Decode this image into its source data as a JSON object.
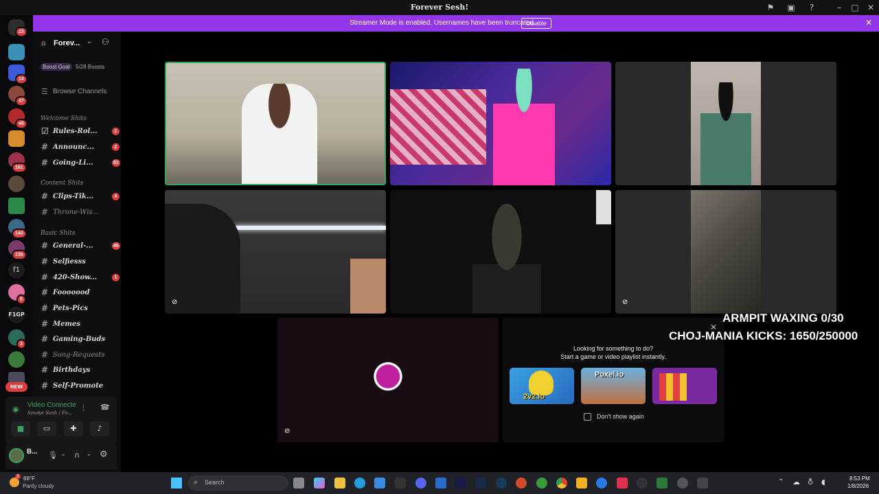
{
  "window": {
    "title": "Forever Sesh!"
  },
  "banner": {
    "text": "Streamer Mode is enabled. Usernames have been truncated.",
    "button": "Disable"
  },
  "guild_badges": [
    "23",
    "14",
    "47",
    "45",
    "161",
    "140",
    "136",
    "5",
    "3"
  ],
  "guild_text": {
    "f1": "f1",
    "f1gp": "F1GP",
    "new": "NEW"
  },
  "server": {
    "name": "Forev...",
    "boost_goal": "Boost Goal",
    "boosts": "5/28 Boosts",
    "browse": "Browse Channels"
  },
  "categories": [
    {
      "name": "Welcome Shits"
    },
    {
      "name": "Content Shits"
    },
    {
      "name": "Basic Shits"
    }
  ],
  "channels": [
    {
      "label": "Rules-Rol...",
      "badge": "2"
    },
    {
      "label": "Announc...",
      "badge": "2"
    },
    {
      "label": "Going-Li...",
      "badge": "81"
    },
    {
      "label": "Clips-Tik...",
      "badge": "4"
    },
    {
      "label": "Throne-Wis...",
      "badge": ""
    },
    {
      "label": "General-...",
      "badge": "46"
    },
    {
      "label": "Selfiesss",
      "badge": ""
    },
    {
      "label": "420-Show...",
      "badge": "1"
    },
    {
      "label": "Fooooood",
      "badge": ""
    },
    {
      "label": "Pets-Pics",
      "badge": ""
    },
    {
      "label": "Memes",
      "badge": ""
    },
    {
      "label": "Gaming-Buds",
      "badge": ""
    },
    {
      "label": "Song-Requests",
      "badge": ""
    },
    {
      "label": "Birthdays",
      "badge": ""
    },
    {
      "label": "Self-Promote",
      "badge": ""
    }
  ],
  "voice": {
    "status": "Video Connecte",
    "channel": "Smoke Sesh / Fo..."
  },
  "user": {
    "name": "B..."
  },
  "overlay": {
    "line1": "ARMPIT WAXING 0/30",
    "line2": "CHOJ-MANIA KICKS: 1650/250000"
  },
  "activity": {
    "title": "Looking for something to do?",
    "subtitle": "Start a game or video playlist instantly.",
    "games": [
      "2v2.io",
      "Poxel.io",
      ""
    ],
    "checkbox": "Don't show again"
  },
  "taskbar": {
    "weather_temp": "66°F",
    "weather_desc": "Partly cloudy",
    "search": "Search",
    "time": "8:53 PM",
    "date": "1/8/2026",
    "weather_badge": "3"
  }
}
